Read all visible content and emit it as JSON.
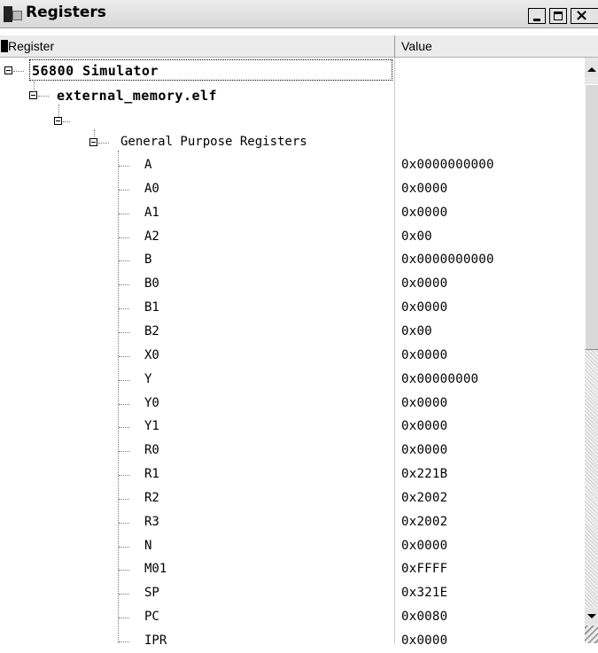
{
  "window": {
    "title": "Registers"
  },
  "columns": {
    "register": "Register",
    "value": "Value"
  },
  "tree": {
    "root": "56800 Simulator",
    "target": "external_memory.elf",
    "group": "General Purpose Registers"
  },
  "registers": [
    {
      "name": "A",
      "value": "0x0000000000"
    },
    {
      "name": "A0",
      "value": "0x0000"
    },
    {
      "name": "A1",
      "value": "0x0000"
    },
    {
      "name": "A2",
      "value": "0x00"
    },
    {
      "name": "B",
      "value": "0x0000000000"
    },
    {
      "name": "B0",
      "value": "0x0000"
    },
    {
      "name": "B1",
      "value": "0x0000"
    },
    {
      "name": "B2",
      "value": "0x00"
    },
    {
      "name": "X0",
      "value": "0x0000"
    },
    {
      "name": "Y",
      "value": "0x00000000"
    },
    {
      "name": "Y0",
      "value": "0x0000"
    },
    {
      "name": "Y1",
      "value": "0x0000"
    },
    {
      "name": "R0",
      "value": "0x0000"
    },
    {
      "name": "R1",
      "value": "0x221B"
    },
    {
      "name": "R2",
      "value": "0x2002"
    },
    {
      "name": "R3",
      "value": "0x2002"
    },
    {
      "name": "N",
      "value": "0x0000"
    },
    {
      "name": "M01",
      "value": "0xFFFF"
    },
    {
      "name": "SP",
      "value": "0x321E"
    },
    {
      "name": "PC",
      "value": "0x0080"
    },
    {
      "name": "IPR",
      "value": "0x0000"
    }
  ]
}
